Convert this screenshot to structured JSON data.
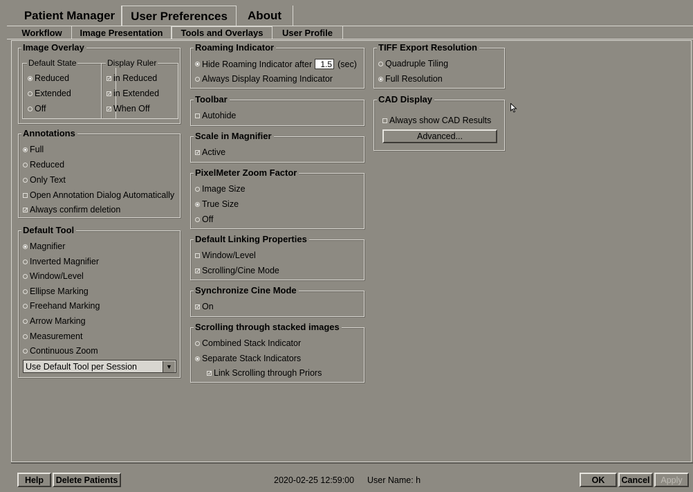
{
  "top_tabs": [
    {
      "label": "Patient Manager"
    },
    {
      "label": "User Preferences"
    },
    {
      "label": "About"
    }
  ],
  "sub_tabs": [
    {
      "label": "Workflow"
    },
    {
      "label": "Image Presentation"
    },
    {
      "label": "Tools and Overlays"
    },
    {
      "label": "User Profile"
    }
  ],
  "image_overlay": {
    "title": "Image Overlay",
    "default_state": {
      "title": "Default State",
      "options": [
        "Reduced",
        "Extended",
        "Off"
      ],
      "selected": "Reduced"
    },
    "display_ruler": {
      "title": "Display Ruler",
      "options": [
        {
          "label": "in Reduced",
          "checked": true
        },
        {
          "label": "in Extended",
          "checked": true
        },
        {
          "label": "When Off",
          "checked": true
        }
      ]
    }
  },
  "annotations": {
    "title": "Annotations",
    "options": [
      "Full",
      "Reduced",
      "Only Text"
    ],
    "selected": "Full",
    "checks": [
      {
        "label": "Open Annotation Dialog Automatically",
        "checked": false
      },
      {
        "label": "Always confirm deletion",
        "checked": true
      }
    ]
  },
  "default_tool": {
    "title": "Default Tool",
    "options": [
      "Magnifier",
      "Inverted Magnifier",
      "Window/Level",
      "Ellipse Marking",
      "Freehand Marking",
      "Arrow Marking",
      "Measurement",
      "Continuous Zoom"
    ],
    "selected": "Magnifier",
    "dropdown_value": "Use Default Tool per Session"
  },
  "roaming_indicator": {
    "title": "Roaming Indicator",
    "hide_label": "Hide Roaming Indicator after",
    "hide_value": "1.5",
    "unit": "(sec)",
    "always_label": "Always Display Roaming Indicator",
    "selected": "hide"
  },
  "toolbar": {
    "title": "Toolbar",
    "autohide_label": "Autohide",
    "autohide_checked": false
  },
  "scale_in_magnifier": {
    "title": "Scale in Magnifier",
    "active_label": "Active",
    "active_checked": true
  },
  "pixelmeter": {
    "title": "PixelMeter Zoom Factor",
    "options": [
      "Image Size",
      "True Size",
      "Off"
    ],
    "selected": "True Size"
  },
  "default_linking": {
    "title": "Default Linking Properties",
    "checks": [
      {
        "label": "Window/Level",
        "checked": false
      },
      {
        "label": "Scrolling/Cine Mode",
        "checked": true
      }
    ]
  },
  "synchronize_cine": {
    "title": "Synchronize Cine Mode",
    "on_label": "On",
    "on_checked": true
  },
  "scrolling_stacked": {
    "title": "Scrolling through stacked images",
    "options": [
      "Combined Stack Indicator",
      "Separate Stack Indicators"
    ],
    "selected": "Separate Stack Indicators",
    "link_label": "Link Scrolling through Priors",
    "link_checked": true
  },
  "tiff_export": {
    "title": "TIFF Export Resolution",
    "options": [
      "Quadruple Tiling",
      "Full Resolution"
    ],
    "selected": "Full Resolution"
  },
  "cad_display": {
    "title": "CAD Display",
    "always_label": "Always show CAD Results",
    "always_checked": false,
    "advanced_label": "Advanced..."
  },
  "bottom": {
    "help": "Help",
    "delete_patients": "Delete Patients",
    "datetime": "2020-02-25  12:59:00",
    "user_label": "User Name:  h",
    "ok": "OK",
    "cancel": "Cancel",
    "apply": "Apply"
  }
}
